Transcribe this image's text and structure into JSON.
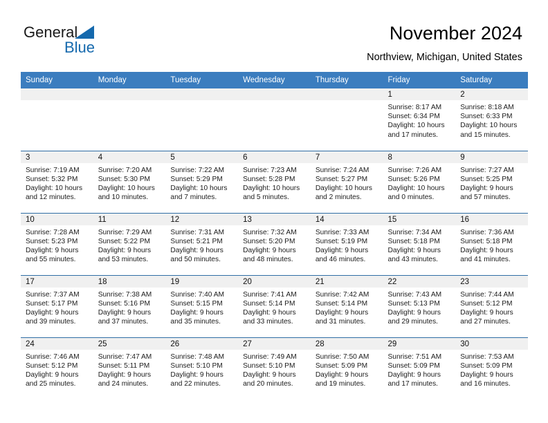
{
  "brand": {
    "name_top": "General",
    "name_bottom": "Blue",
    "accent_color": "#1569ad"
  },
  "header": {
    "title": "November 2024",
    "subtitle": "Northview, Michigan, United States"
  },
  "calendar": {
    "header_bg": "#3b7dbf",
    "daynum_band_bg": "#f0f0f0",
    "weekday_names": [
      "Sunday",
      "Monday",
      "Tuesday",
      "Wednesday",
      "Thursday",
      "Friday",
      "Saturday"
    ],
    "weeks": [
      [
        {
          "day": "",
          "empty": true
        },
        {
          "day": "",
          "empty": true
        },
        {
          "day": "",
          "empty": true
        },
        {
          "day": "",
          "empty": true
        },
        {
          "day": "",
          "empty": true
        },
        {
          "day": "1",
          "sunrise": "Sunrise: 8:17 AM",
          "sunset": "Sunset: 6:34 PM",
          "daylight1": "Daylight: 10 hours",
          "daylight2": "and 17 minutes."
        },
        {
          "day": "2",
          "sunrise": "Sunrise: 8:18 AM",
          "sunset": "Sunset: 6:33 PM",
          "daylight1": "Daylight: 10 hours",
          "daylight2": "and 15 minutes."
        }
      ],
      [
        {
          "day": "3",
          "sunrise": "Sunrise: 7:19 AM",
          "sunset": "Sunset: 5:32 PM",
          "daylight1": "Daylight: 10 hours",
          "daylight2": "and 12 minutes."
        },
        {
          "day": "4",
          "sunrise": "Sunrise: 7:20 AM",
          "sunset": "Sunset: 5:30 PM",
          "daylight1": "Daylight: 10 hours",
          "daylight2": "and 10 minutes."
        },
        {
          "day": "5",
          "sunrise": "Sunrise: 7:22 AM",
          "sunset": "Sunset: 5:29 PM",
          "daylight1": "Daylight: 10 hours",
          "daylight2": "and 7 minutes."
        },
        {
          "day": "6",
          "sunrise": "Sunrise: 7:23 AM",
          "sunset": "Sunset: 5:28 PM",
          "daylight1": "Daylight: 10 hours",
          "daylight2": "and 5 minutes."
        },
        {
          "day": "7",
          "sunrise": "Sunrise: 7:24 AM",
          "sunset": "Sunset: 5:27 PM",
          "daylight1": "Daylight: 10 hours",
          "daylight2": "and 2 minutes."
        },
        {
          "day": "8",
          "sunrise": "Sunrise: 7:26 AM",
          "sunset": "Sunset: 5:26 PM",
          "daylight1": "Daylight: 10 hours",
          "daylight2": "and 0 minutes."
        },
        {
          "day": "9",
          "sunrise": "Sunrise: 7:27 AM",
          "sunset": "Sunset: 5:25 PM",
          "daylight1": "Daylight: 9 hours",
          "daylight2": "and 57 minutes."
        }
      ],
      [
        {
          "day": "10",
          "sunrise": "Sunrise: 7:28 AM",
          "sunset": "Sunset: 5:23 PM",
          "daylight1": "Daylight: 9 hours",
          "daylight2": "and 55 minutes."
        },
        {
          "day": "11",
          "sunrise": "Sunrise: 7:29 AM",
          "sunset": "Sunset: 5:22 PM",
          "daylight1": "Daylight: 9 hours",
          "daylight2": "and 53 minutes."
        },
        {
          "day": "12",
          "sunrise": "Sunrise: 7:31 AM",
          "sunset": "Sunset: 5:21 PM",
          "daylight1": "Daylight: 9 hours",
          "daylight2": "and 50 minutes."
        },
        {
          "day": "13",
          "sunrise": "Sunrise: 7:32 AM",
          "sunset": "Sunset: 5:20 PM",
          "daylight1": "Daylight: 9 hours",
          "daylight2": "and 48 minutes."
        },
        {
          "day": "14",
          "sunrise": "Sunrise: 7:33 AM",
          "sunset": "Sunset: 5:19 PM",
          "daylight1": "Daylight: 9 hours",
          "daylight2": "and 46 minutes."
        },
        {
          "day": "15",
          "sunrise": "Sunrise: 7:34 AM",
          "sunset": "Sunset: 5:18 PM",
          "daylight1": "Daylight: 9 hours",
          "daylight2": "and 43 minutes."
        },
        {
          "day": "16",
          "sunrise": "Sunrise: 7:36 AM",
          "sunset": "Sunset: 5:18 PM",
          "daylight1": "Daylight: 9 hours",
          "daylight2": "and 41 minutes."
        }
      ],
      [
        {
          "day": "17",
          "sunrise": "Sunrise: 7:37 AM",
          "sunset": "Sunset: 5:17 PM",
          "daylight1": "Daylight: 9 hours",
          "daylight2": "and 39 minutes."
        },
        {
          "day": "18",
          "sunrise": "Sunrise: 7:38 AM",
          "sunset": "Sunset: 5:16 PM",
          "daylight1": "Daylight: 9 hours",
          "daylight2": "and 37 minutes."
        },
        {
          "day": "19",
          "sunrise": "Sunrise: 7:40 AM",
          "sunset": "Sunset: 5:15 PM",
          "daylight1": "Daylight: 9 hours",
          "daylight2": "and 35 minutes."
        },
        {
          "day": "20",
          "sunrise": "Sunrise: 7:41 AM",
          "sunset": "Sunset: 5:14 PM",
          "daylight1": "Daylight: 9 hours",
          "daylight2": "and 33 minutes."
        },
        {
          "day": "21",
          "sunrise": "Sunrise: 7:42 AM",
          "sunset": "Sunset: 5:14 PM",
          "daylight1": "Daylight: 9 hours",
          "daylight2": "and 31 minutes."
        },
        {
          "day": "22",
          "sunrise": "Sunrise: 7:43 AM",
          "sunset": "Sunset: 5:13 PM",
          "daylight1": "Daylight: 9 hours",
          "daylight2": "and 29 minutes."
        },
        {
          "day": "23",
          "sunrise": "Sunrise: 7:44 AM",
          "sunset": "Sunset: 5:12 PM",
          "daylight1": "Daylight: 9 hours",
          "daylight2": "and 27 minutes."
        }
      ],
      [
        {
          "day": "24",
          "sunrise": "Sunrise: 7:46 AM",
          "sunset": "Sunset: 5:12 PM",
          "daylight1": "Daylight: 9 hours",
          "daylight2": "and 25 minutes."
        },
        {
          "day": "25",
          "sunrise": "Sunrise: 7:47 AM",
          "sunset": "Sunset: 5:11 PM",
          "daylight1": "Daylight: 9 hours",
          "daylight2": "and 24 minutes."
        },
        {
          "day": "26",
          "sunrise": "Sunrise: 7:48 AM",
          "sunset": "Sunset: 5:10 PM",
          "daylight1": "Daylight: 9 hours",
          "daylight2": "and 22 minutes."
        },
        {
          "day": "27",
          "sunrise": "Sunrise: 7:49 AM",
          "sunset": "Sunset: 5:10 PM",
          "daylight1": "Daylight: 9 hours",
          "daylight2": "and 20 minutes."
        },
        {
          "day": "28",
          "sunrise": "Sunrise: 7:50 AM",
          "sunset": "Sunset: 5:09 PM",
          "daylight1": "Daylight: 9 hours",
          "daylight2": "and 19 minutes."
        },
        {
          "day": "29",
          "sunrise": "Sunrise: 7:51 AM",
          "sunset": "Sunset: 5:09 PM",
          "daylight1": "Daylight: 9 hours",
          "daylight2": "and 17 minutes."
        },
        {
          "day": "30",
          "sunrise": "Sunrise: 7:53 AM",
          "sunset": "Sunset: 5:09 PM",
          "daylight1": "Daylight: 9 hours",
          "daylight2": "and 16 minutes."
        }
      ]
    ]
  }
}
